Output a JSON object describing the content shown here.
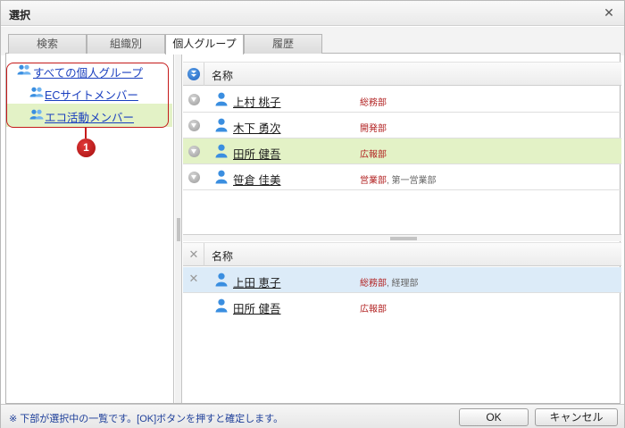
{
  "dialog": {
    "title": "選択",
    "close_glyph": "✕"
  },
  "tabs": [
    {
      "label": "検索",
      "active": false
    },
    {
      "label": "組織別",
      "active": false
    },
    {
      "label": "個人グループ",
      "active": true
    },
    {
      "label": "履歴",
      "active": false
    }
  ],
  "tree": {
    "items": [
      {
        "label": "すべての個人グループ",
        "icon": "group-icon",
        "indent": 0,
        "selected": false
      },
      {
        "label": "ECサイトメンバー",
        "icon": "group-icon",
        "indent": 1,
        "selected": false
      },
      {
        "label": "エコ活動メンバー",
        "icon": "group-icon",
        "indent": 1,
        "selected": true
      }
    ],
    "callout_number": "1"
  },
  "candidates": {
    "header": {
      "name_label": "名称",
      "icon": "add-all-icon"
    },
    "rows": [
      {
        "name": "上村 桃子",
        "dept_primary": "総務部",
        "dept_rest": "",
        "highlighted": false,
        "icon": "add-icon"
      },
      {
        "name": "木下 勇次",
        "dept_primary": "開発部",
        "dept_rest": "",
        "highlighted": false,
        "icon": "add-icon"
      },
      {
        "name": "田所 健吾",
        "dept_primary": "広報部",
        "dept_rest": "",
        "highlighted": true,
        "icon": "add-icon"
      },
      {
        "name": "笹倉 佳美",
        "dept_primary": "営業部",
        "dept_rest": ", 第一営業部",
        "highlighted": false,
        "icon": "add-icon"
      }
    ]
  },
  "selected": {
    "header": {
      "name_label": "名称",
      "icon": "remove-all-icon",
      "remove_glyph": "✕"
    },
    "rows": [
      {
        "name": "上田 恵子",
        "dept_primary": "総務部",
        "dept_rest": ", 経理部",
        "highlighted": true,
        "show_remove": true
      },
      {
        "name": "田所 健吾",
        "dept_primary": "広報部",
        "dept_rest": "",
        "highlighted": false,
        "show_remove": false
      }
    ]
  },
  "footer": {
    "note": "※ 下部が選択中の一覧です。[OK]ボタンを押すと確定します。",
    "ok_label": "OK",
    "cancel_label": "キャンセル"
  },
  "colors": {
    "link": "#1a3fbf",
    "dept_primary": "#b22222",
    "highlight_green": "#e3f2c6",
    "highlight_blue": "#dcebf8",
    "callout_red": "#c51a1a"
  }
}
